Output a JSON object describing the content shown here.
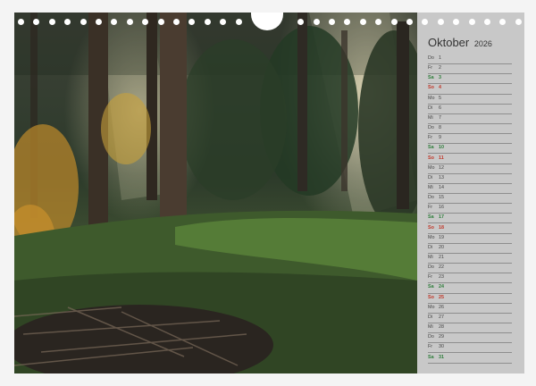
{
  "calendar": {
    "month": "Oktober",
    "year": "2026",
    "days": [
      {
        "wd": "Do",
        "n": "1"
      },
      {
        "wd": "Fr",
        "n": "2"
      },
      {
        "wd": "Sa",
        "n": "3"
      },
      {
        "wd": "So",
        "n": "4"
      },
      {
        "wd": "Mo",
        "n": "5"
      },
      {
        "wd": "Di",
        "n": "6"
      },
      {
        "wd": "Mi",
        "n": "7"
      },
      {
        "wd": "Do",
        "n": "8"
      },
      {
        "wd": "Fr",
        "n": "9"
      },
      {
        "wd": "Sa",
        "n": "10"
      },
      {
        "wd": "So",
        "n": "11"
      },
      {
        "wd": "Mo",
        "n": "12"
      },
      {
        "wd": "Di",
        "n": "13"
      },
      {
        "wd": "Mi",
        "n": "14"
      },
      {
        "wd": "Do",
        "n": "15"
      },
      {
        "wd": "Fr",
        "n": "16"
      },
      {
        "wd": "Sa",
        "n": "17"
      },
      {
        "wd": "So",
        "n": "18"
      },
      {
        "wd": "Mo",
        "n": "19"
      },
      {
        "wd": "Di",
        "n": "20"
      },
      {
        "wd": "Mi",
        "n": "21"
      },
      {
        "wd": "Do",
        "n": "22"
      },
      {
        "wd": "Fr",
        "n": "23"
      },
      {
        "wd": "Sa",
        "n": "24"
      },
      {
        "wd": "So",
        "n": "25"
      },
      {
        "wd": "Mo",
        "n": "26"
      },
      {
        "wd": "Di",
        "n": "27"
      },
      {
        "wd": "Mi",
        "n": "28"
      },
      {
        "wd": "Do",
        "n": "29"
      },
      {
        "wd": "Fr",
        "n": "30"
      },
      {
        "wd": "Sa",
        "n": "31"
      }
    ]
  },
  "colors": {
    "saturday": "#2e7d3a",
    "sunday": "#c0392b",
    "panel": "#c8c8c8"
  }
}
